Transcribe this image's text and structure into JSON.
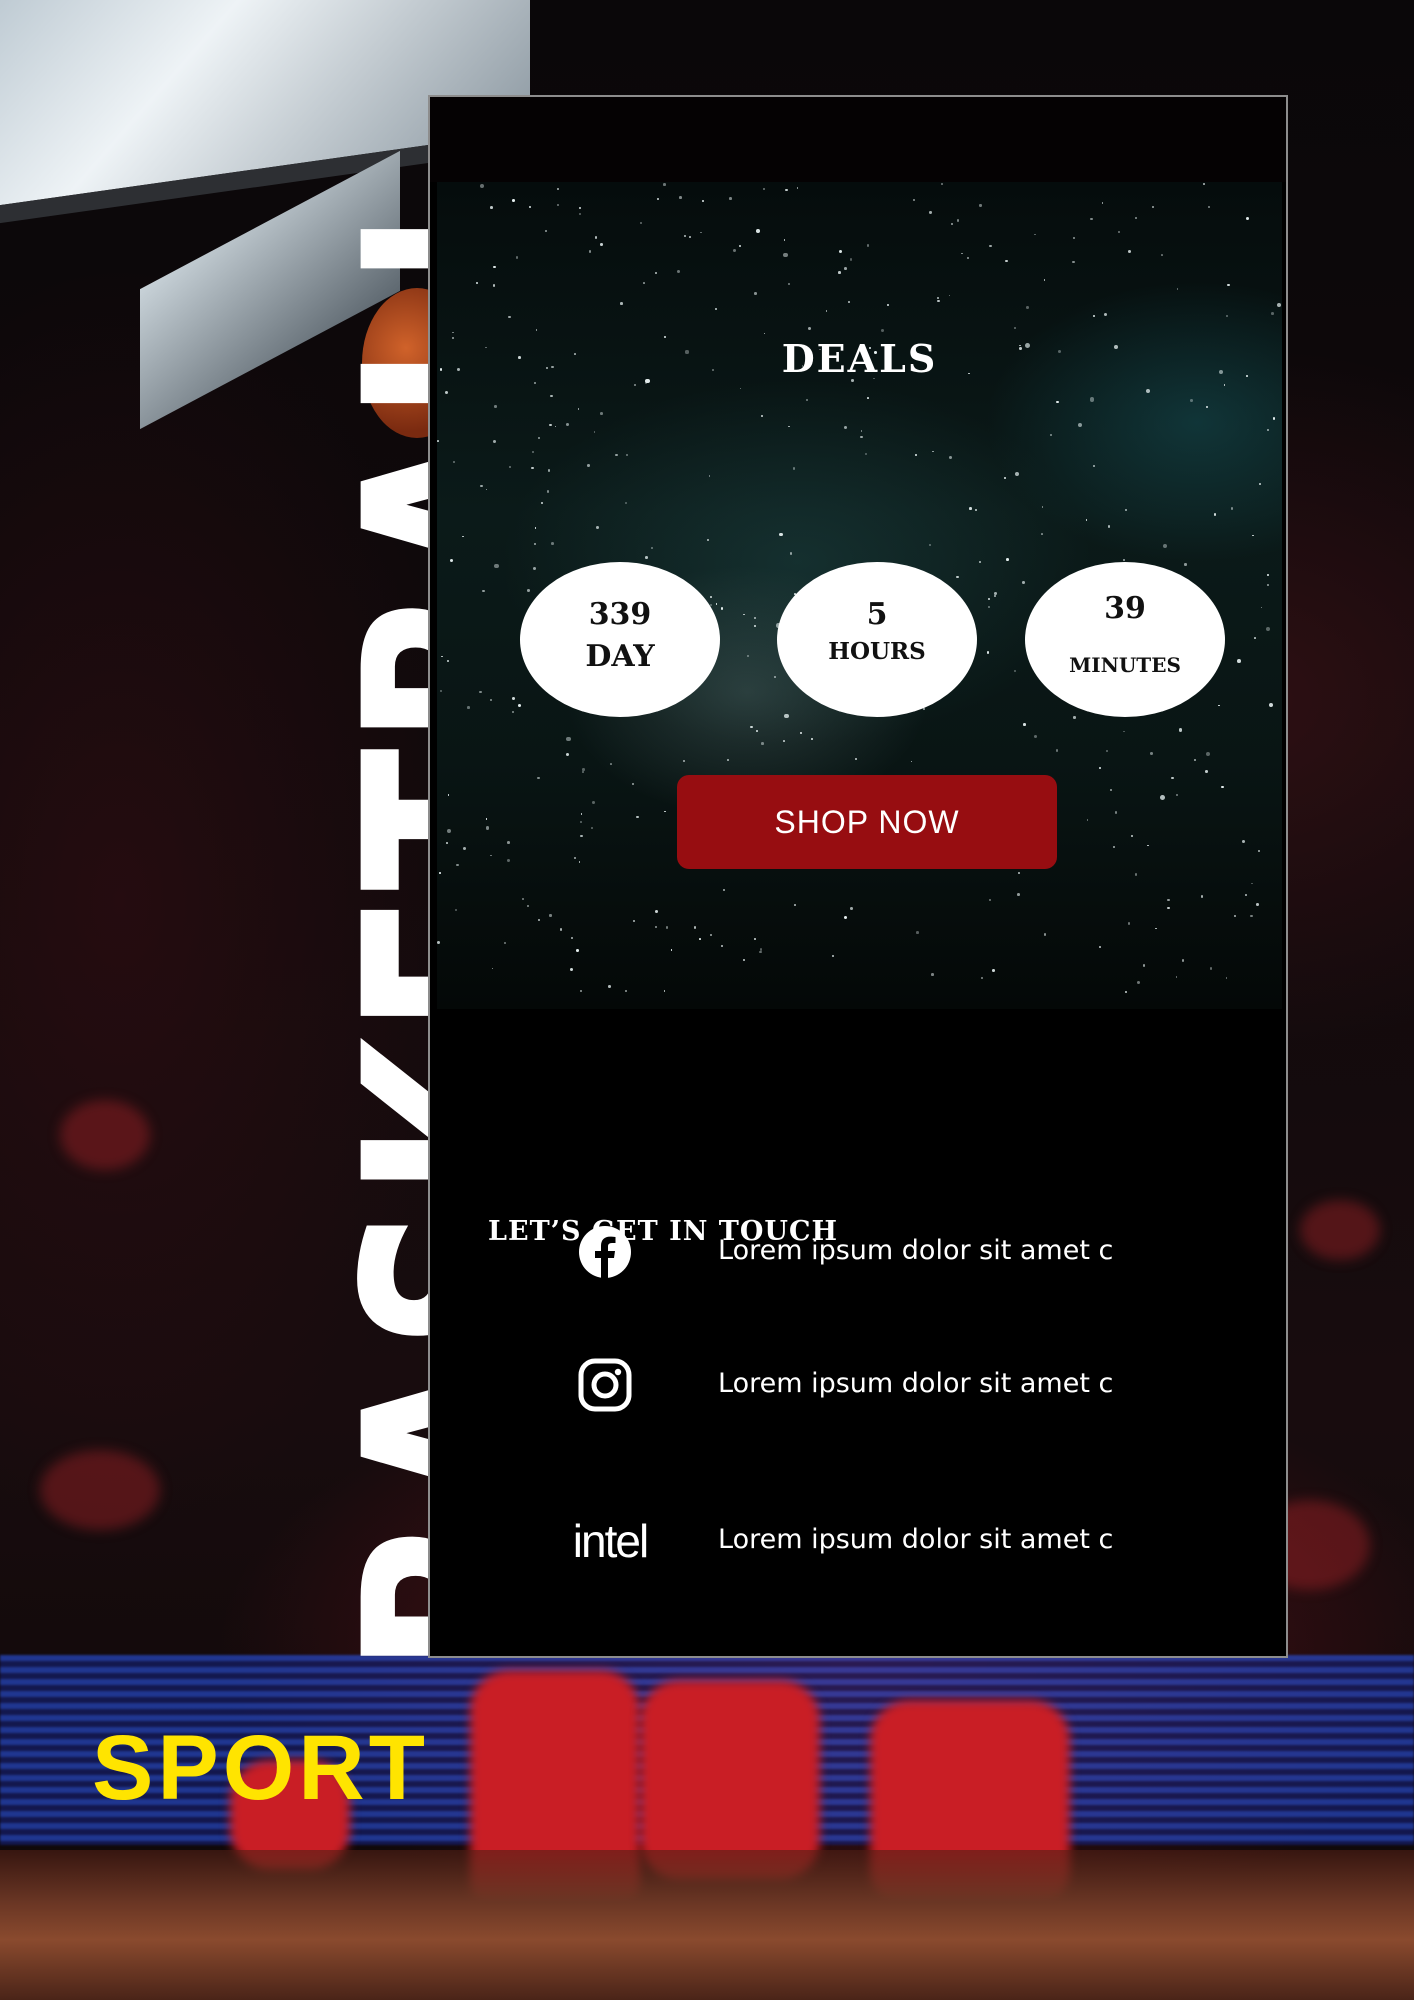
{
  "poster": {
    "title": "BASKETBALL",
    "subtitle": "SPORT"
  },
  "deals": {
    "title": "DEALS",
    "countdown": [
      {
        "value": "339",
        "unit": "DAY"
      },
      {
        "value": "5",
        "unit": "HOURS"
      },
      {
        "value": "39",
        "unit": "MINUTES"
      }
    ],
    "cta_label": "SHOP NOW"
  },
  "contact": {
    "title": "LET’S GET IN TOUCH",
    "rows": [
      {
        "icon": "facebook-icon",
        "text": "Lorem ipsum dolor sit amet c"
      },
      {
        "icon": "instagram-icon",
        "text": "Lorem ipsum dolor sit amet c"
      },
      {
        "icon": "intel-logo",
        "logo_text": "intel",
        "text": "Lorem ipsum dolor sit amet c"
      }
    ]
  },
  "colors": {
    "accent_yellow": "#ffe400",
    "button_red": "#970d11",
    "card_border": "#8d8d8d"
  }
}
